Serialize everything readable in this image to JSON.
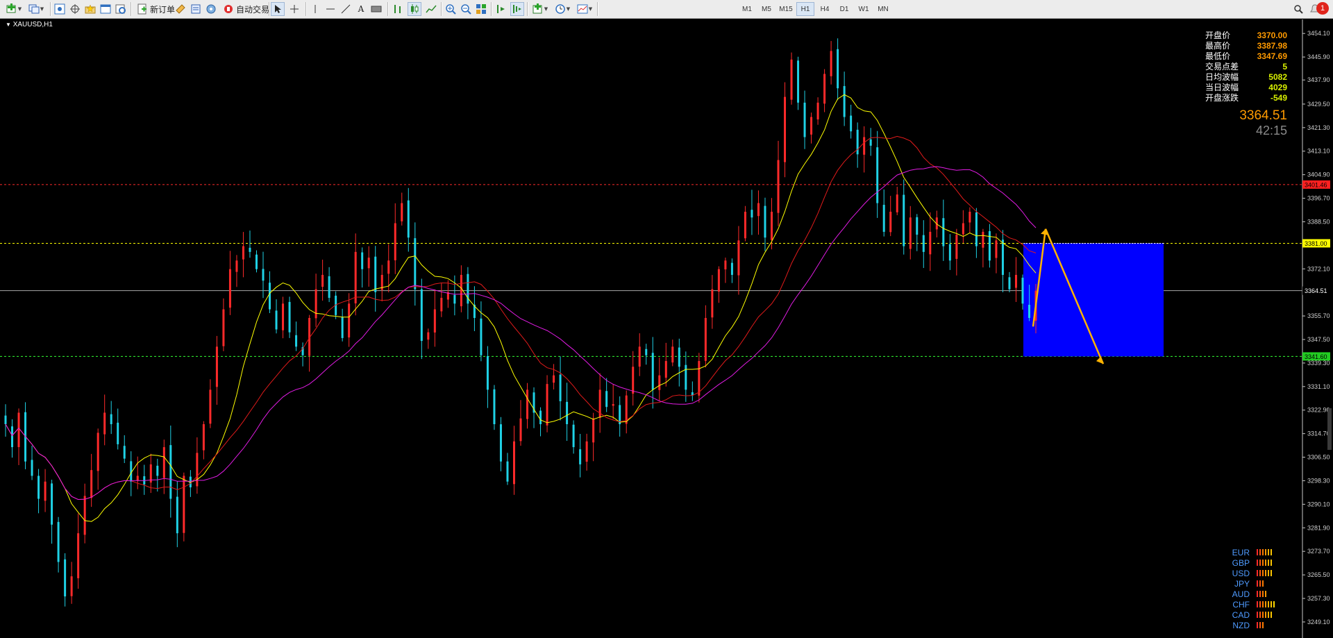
{
  "toolbar": {
    "new_order_label": "新订单",
    "auto_trade_label": "自动交易",
    "periods": [
      "M1",
      "M5",
      "M15",
      "H1",
      "H4",
      "D1",
      "W1",
      "MN"
    ],
    "active_period": "H1",
    "notification_count": "1"
  },
  "chart": {
    "title": "XAUUSD,H1",
    "current_price_label": "3364.51",
    "level_labels": {
      "upper": "3401.46",
      "middle": "3381.00",
      "lower": "3341.60"
    },
    "y_ticks": [
      "3454.10",
      "3445.90",
      "3437.90",
      "3429.50",
      "3421.30",
      "3413.10",
      "3404.90",
      "3396.70",
      "3388.50",
      "3380.40",
      "3372.10",
      "3364.00",
      "3355.70",
      "3347.50",
      "3339.30",
      "3331.10",
      "3322.90",
      "3314.70",
      "3306.50",
      "3298.30",
      "3290.10",
      "3281.90",
      "3273.70",
      "3265.50",
      "3257.30",
      "3249.10"
    ]
  },
  "info_panel": {
    "rows": [
      {
        "label": "开盘价",
        "value": "3370.00",
        "color": "#ff9a00"
      },
      {
        "label": "最高价",
        "value": "3387.98",
        "color": "#ff9a00"
      },
      {
        "label": "最低价",
        "value": "3347.69",
        "color": "#ff9a00"
      },
      {
        "label": "交易点差",
        "value": "5",
        "color": "#d8f000"
      },
      {
        "label": "日均波幅",
        "value": "5082",
        "color": "#d8f000"
      },
      {
        "label": "当日波幅",
        "value": "4029",
        "color": "#d8f000"
      },
      {
        "label": "开盘涨跌",
        "value": "-549",
        "color": "#d8f000"
      }
    ],
    "current_price": "3364.51",
    "countdown": "42:15"
  },
  "currency_meter": [
    {
      "name": "EUR",
      "level": 6
    },
    {
      "name": "GBP",
      "level": 6
    },
    {
      "name": "USD",
      "level": 6
    },
    {
      "name": "JPY",
      "level": 3
    },
    {
      "name": "AUD",
      "level": 4
    },
    {
      "name": "CHF",
      "level": 7
    },
    {
      "name": "CAD",
      "level": 6
    },
    {
      "name": "NZD",
      "level": 3
    }
  ],
  "colors": {
    "bull": "#ff2a2a",
    "bear": "#1fd2e6",
    "ma_fast": "#ffff00",
    "ma_mid": "#e11b1b",
    "ma_slow": "#e21ce4",
    "zone": "#0000ff",
    "arrow": "#ffb300"
  },
  "chart_data": {
    "type": "candlestick",
    "symbol": "XAUUSD",
    "timeframe": "H1",
    "ylim": [
      3244.0,
      3458.5
    ],
    "current_price": 3364.51,
    "levels": [
      {
        "name": "upper",
        "price": 3401.46,
        "color": "#ff2a2a"
      },
      {
        "name": "middle",
        "price": 3381.0,
        "color": "#ffff00"
      },
      {
        "name": "lower",
        "price": 3341.6,
        "color": "#33ff33"
      }
    ],
    "closes": [
      3318,
      3310,
      3322,
      3305,
      3300,
      3292,
      3298,
      3283,
      3270,
      3258,
      3265,
      3280,
      3293,
      3302,
      3315,
      3322,
      3318,
      3311,
      3306,
      3298,
      3300,
      3297,
      3304,
      3300,
      3310,
      3292,
      3280,
      3300,
      3296,
      3308,
      3318,
      3330,
      3345,
      3358,
      3372,
      3375,
      3380,
      3378,
      3372,
      3368,
      3358,
      3351,
      3360,
      3350,
      3345,
      3342,
      3355,
      3365,
      3370,
      3362,
      3356,
      3348,
      3360,
      3378,
      3372,
      3376,
      3364,
      3370,
      3375,
      3388,
      3395,
      3383,
      3365,
      3347,
      3350,
      3358,
      3362,
      3364,
      3360,
      3370,
      3360,
      3355,
      3342,
      3330,
      3318,
      3305,
      3298,
      3312,
      3320,
      3330,
      3322,
      3318,
      3332,
      3335,
      3326,
      3318,
      3310,
      3304,
      3312,
      3320,
      3330,
      3324,
      3325,
      3318,
      3328,
      3338,
      3345,
      3342,
      3330,
      3335,
      3340,
      3345,
      3338,
      3330,
      3328,
      3340,
      3355,
      3365,
      3372,
      3375,
      3370,
      3382,
      3392,
      3390,
      3395,
      3383,
      3392,
      3410,
      3432,
      3445,
      3430,
      3418,
      3425,
      3430,
      3440,
      3448,
      3435,
      3425,
      3420,
      3412,
      3418,
      3415,
      3395,
      3385,
      3392,
      3398,
      3380,
      3390,
      3384,
      3378,
      3385,
      3390,
      3380,
      3375,
      3384,
      3388,
      3392,
      3380,
      3385,
      3375,
      3382,
      3370,
      3365,
      3370,
      3360,
      3355,
      3364.5
    ]
  }
}
